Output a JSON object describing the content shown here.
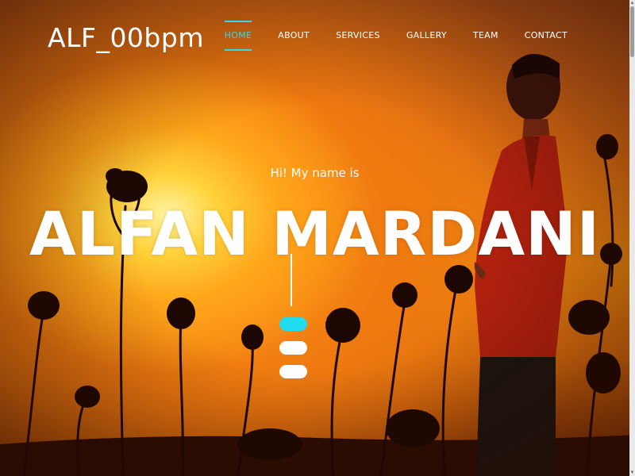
{
  "brand": "ALF_00bpm",
  "nav": {
    "items": [
      {
        "label": "HOME",
        "active": true
      },
      {
        "label": "ABOUT",
        "active": false
      },
      {
        "label": "SERVICES",
        "active": false
      },
      {
        "label": "GALLERY",
        "active": false
      },
      {
        "label": "TEAM",
        "active": false
      },
      {
        "label": "CONTACT",
        "active": false
      }
    ]
  },
  "hero": {
    "greeting": "Hi! My name is",
    "name": "ALFAN MARDANI",
    "slides": 3,
    "active_slide": 0
  },
  "colors": {
    "accent": "#35d8e8",
    "dot_active": "#21dcef",
    "text": "#ffffff"
  }
}
